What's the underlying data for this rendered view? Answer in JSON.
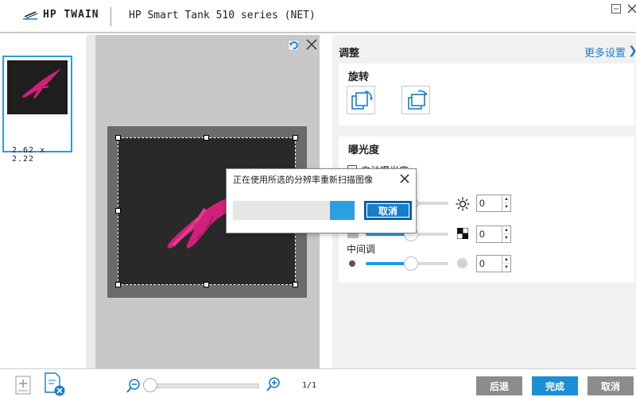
{
  "app": {
    "logo_text": "HP TWAIN",
    "window_title": "HP Smart Tank 510 series (NET)"
  },
  "thumbnails": [
    {
      "size": "2.62  x  2.22"
    }
  ],
  "right_panel": {
    "title": "调整",
    "more_settings": "更多设置",
    "rotate": {
      "title": "旋转"
    },
    "exposure": {
      "title": "曝光度",
      "auto_exposure_label": "自动曝光度",
      "auto_exposure_checked": false,
      "brightness": {
        "value": "0",
        "fill": 0.55
      },
      "contrast": {
        "value": "0",
        "fill": 0.55
      },
      "midtones": {
        "label": "中间调",
        "value": "0",
        "fill": 0.55
      }
    }
  },
  "dialog": {
    "title": "正在使用所选的分辨率重新扫描图像",
    "cancel_label": "取消",
    "progress": 0.2
  },
  "bottom": {
    "page_count": "1/1",
    "back_label": "后退",
    "done_label": "完成",
    "cancel_label": "取消"
  },
  "colors": {
    "accent": "#1a7dc8",
    "slider": "#1d9ce5",
    "button_gray": "#8c8c8c",
    "button_blue": "#1a8fd6",
    "embroidery": "#d0207a"
  }
}
